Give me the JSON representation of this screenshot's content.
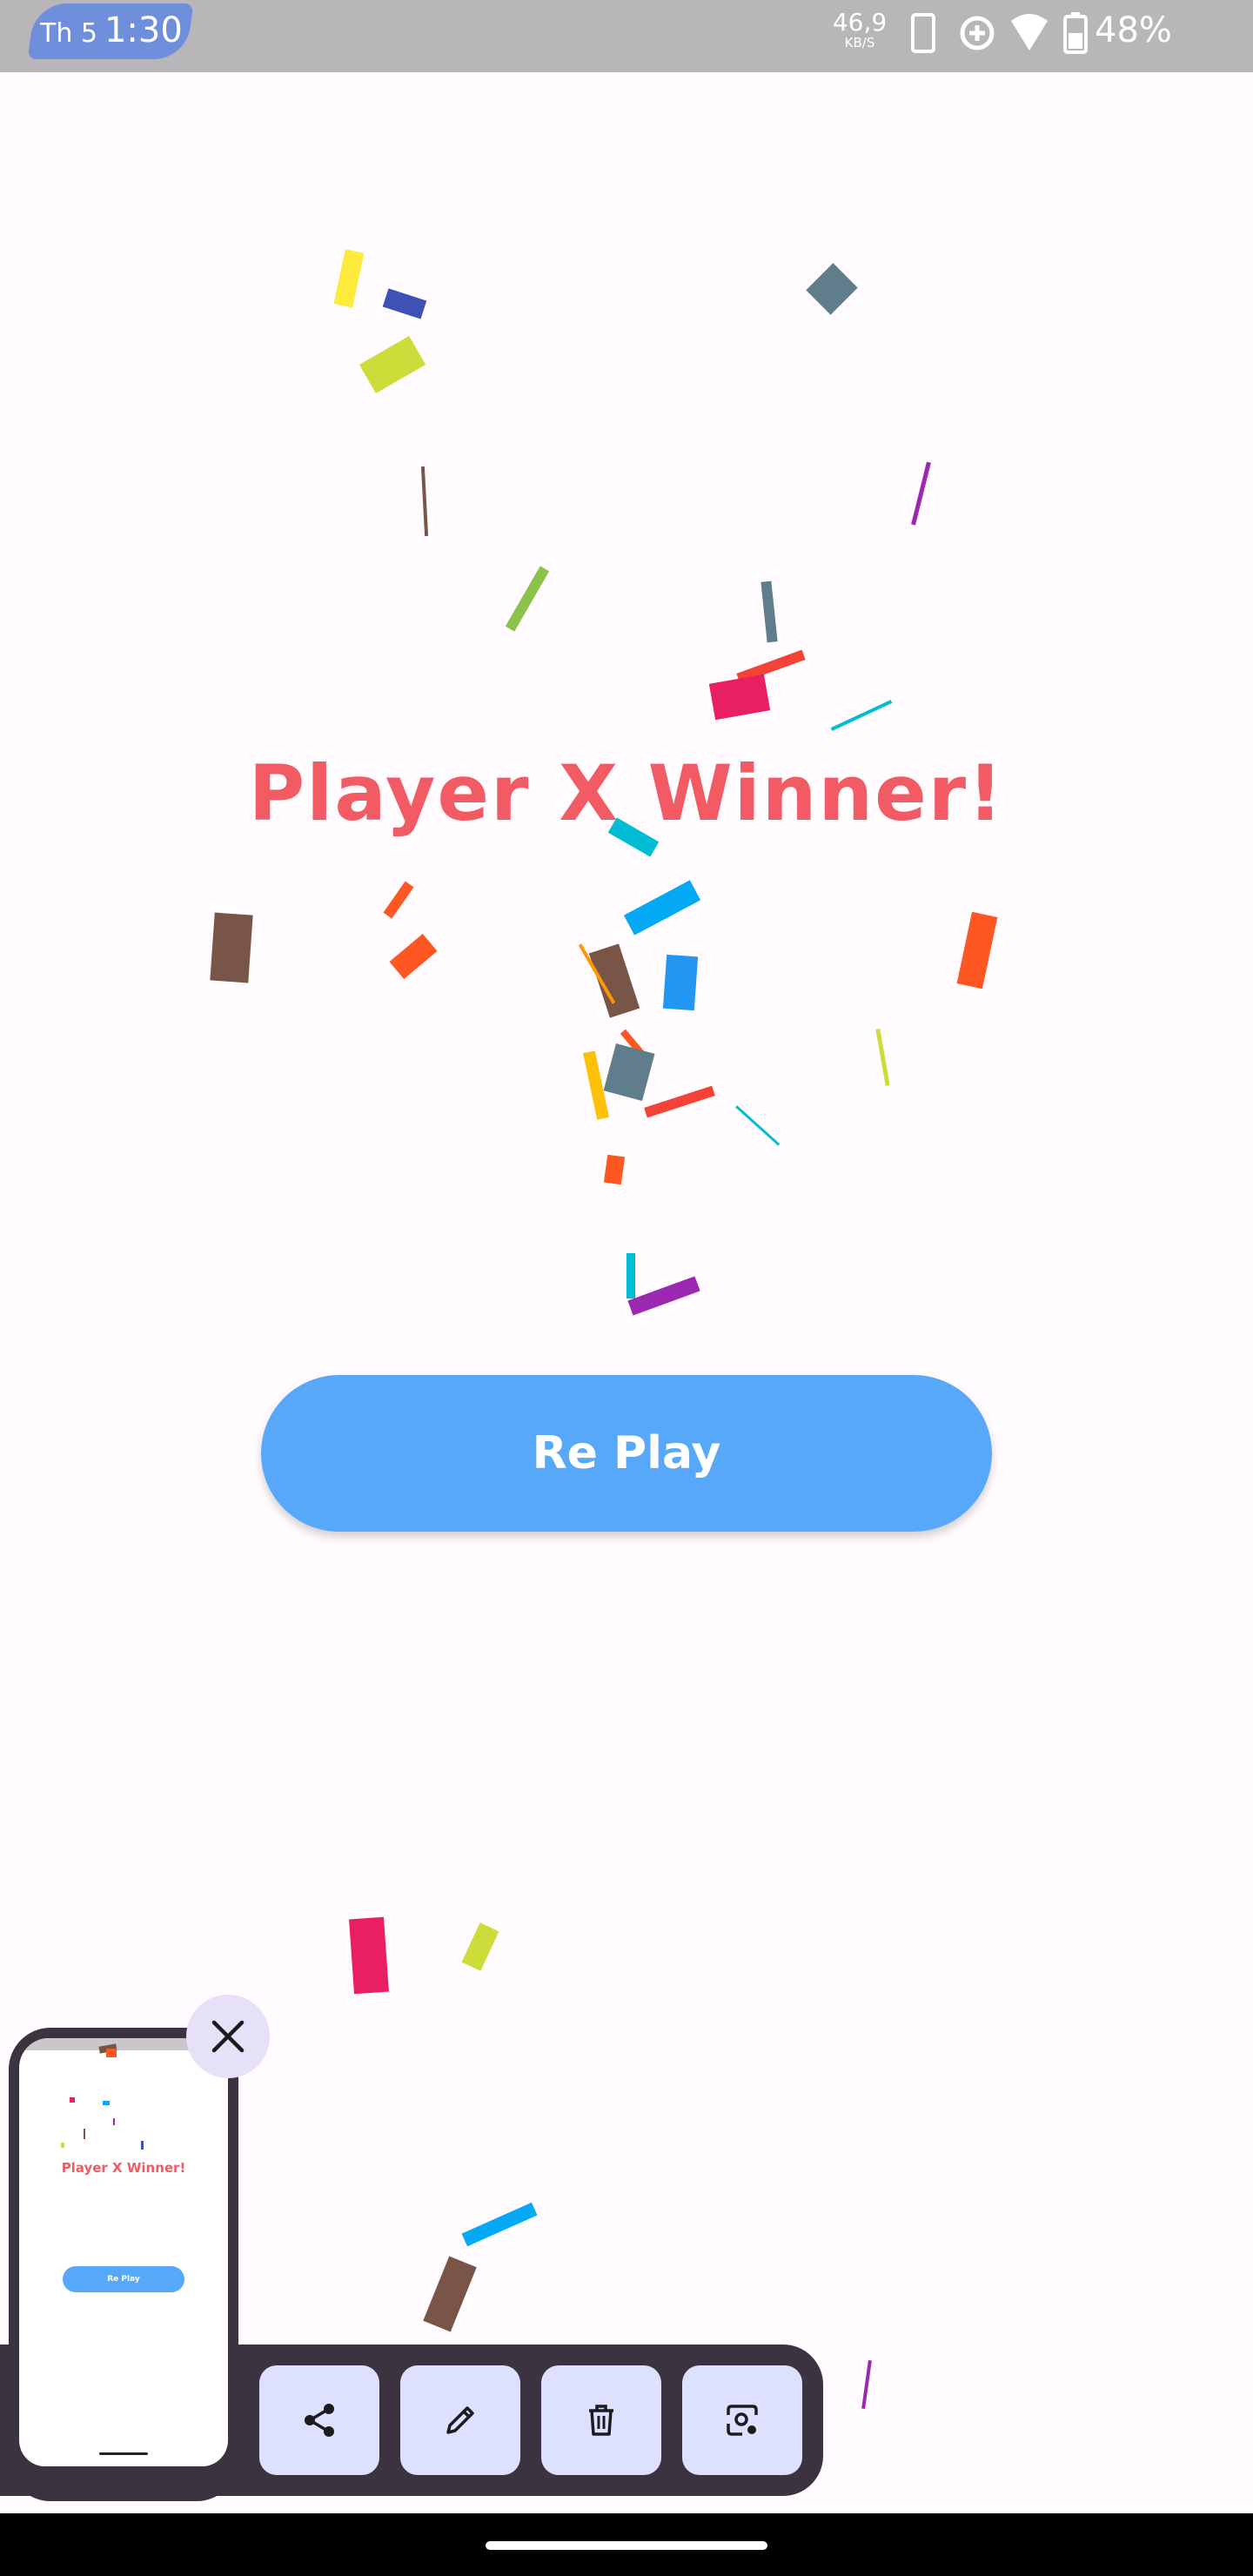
{
  "status_bar": {
    "day": "Th 5",
    "time": "1:30",
    "net_speed_value": "46,9",
    "net_speed_unit": "KB/S",
    "battery_percent": "48%",
    "icons": [
      "phone-icon",
      "data-saver-icon",
      "wifi-icon",
      "battery-icon"
    ]
  },
  "game": {
    "result_text": "Player X Winner!",
    "replay_label": "Re Play"
  },
  "screenshot_preview": {
    "thumbnail_title": "Player X Winner!",
    "thumbnail_replay_label": "Re Play",
    "actions": [
      "share-icon",
      "edit-icon",
      "delete-icon",
      "lens-icon"
    ]
  },
  "colors": {
    "accent": "#57a8f9",
    "title": "#f25b63",
    "background": "#fffbfe",
    "overlay_dark": "#3b3340",
    "action_tile": "#dde1ff"
  }
}
